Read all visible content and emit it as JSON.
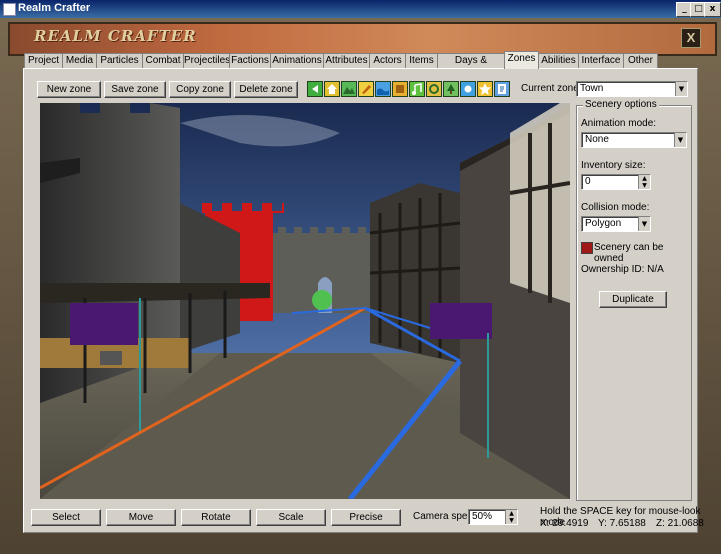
{
  "window": {
    "title": "Realm Crafter",
    "logo_text": "REALM CRAFTER"
  },
  "window_controls": {
    "minimize": "_",
    "maximize": "□",
    "close": "x"
  },
  "banner_close": "X",
  "tabs": [
    "Project",
    "Media",
    "Particles",
    "Combat",
    "Projectiles",
    "Factions",
    "Animations",
    "Attributes",
    "Actors",
    "Items",
    "Days & seasons",
    "Zones",
    "Abilities",
    "Interface",
    "Other"
  ],
  "active_tab": "Zones",
  "toolbar": {
    "new_zone": "New zone",
    "save_zone": "Save zone",
    "copy_zone": "Copy zone",
    "delete_zone": "Delete zone",
    "icons": [
      "arrow-left-icon",
      "house-icon",
      "terrain-icon",
      "pencil-icon",
      "water-icon",
      "box-icon",
      "music-icon",
      "portal-icon",
      "tree-icon",
      "sun-icon",
      "star-icon",
      "script-icon"
    ],
    "current_zone_label": "Current zone:",
    "current_zone_value": "Town"
  },
  "scenery": {
    "legend": "Scenery options",
    "animation_mode_label": "Animation mode:",
    "animation_mode_value": "None",
    "inventory_size_label": "Inventory size:",
    "inventory_size_value": "0",
    "collision_mode_label": "Collision mode:",
    "collision_mode_value": "Polygon",
    "can_be_owned_label": "Scenery can be owned",
    "can_be_owned_color": "#a01818",
    "ownership_id": "Ownership ID: N/A",
    "duplicate": "Duplicate"
  },
  "bottom": {
    "select": "Select",
    "move": "Move",
    "rotate": "Rotate",
    "scale": "Scale",
    "precise": "Precise",
    "camera_speed_label": "Camera speed:",
    "camera_speed_value": "50%",
    "hint": "Hold the SPACE key for mouse-look mode",
    "coord_x": "X: 29.4919",
    "coord_y": "Y: 7.65188",
    "coord_z": "Z: 21.0688"
  },
  "colors": {
    "title_bar": "#0a246a",
    "panel": "#d4d0c8",
    "path_orange": "#e0641e",
    "path_blue": "#2a6ae0",
    "flag_purple": "#4a1870",
    "tower_red": "#d01818"
  }
}
